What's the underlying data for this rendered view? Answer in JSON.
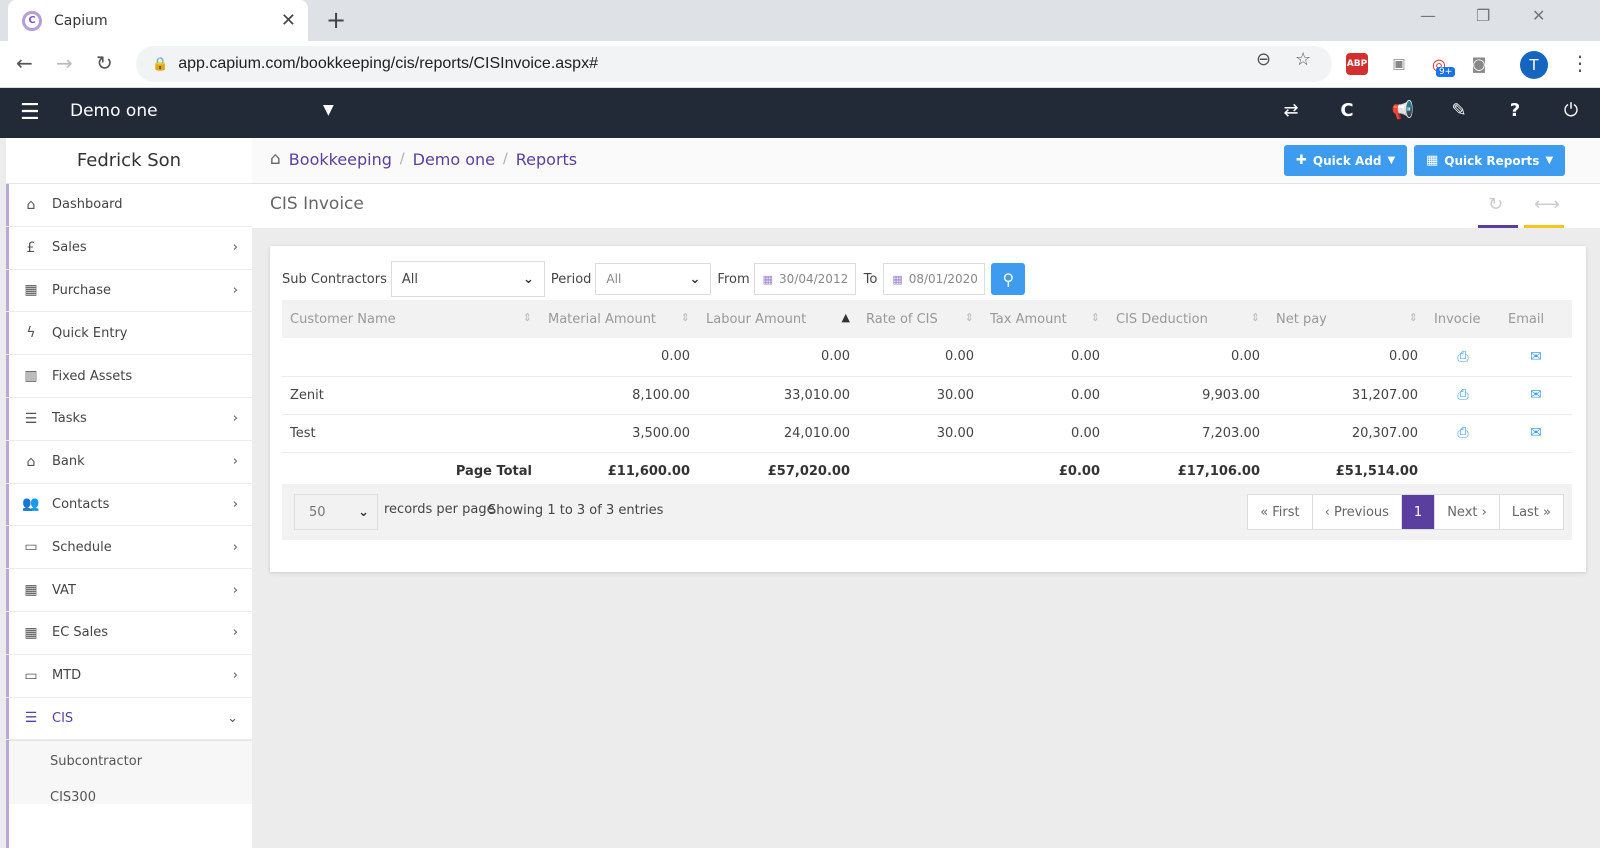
{
  "browser": {
    "tab_title": "Capium",
    "favicon": "C",
    "url": "app.capium.com/bookkeeping/cis/reports/CISInvoice.aspx#",
    "ext_abp": "ABP",
    "ext_badge": "9+",
    "avatar_initial": "T"
  },
  "appbar": {
    "company": "Demo one"
  },
  "sidebar": {
    "user": "Fedrick Son",
    "items": [
      {
        "label": "Dashboard",
        "icon": "home-icon",
        "glyph": "⌂",
        "chevron": ""
      },
      {
        "label": "Sales",
        "icon": "pound-icon",
        "glyph": "£",
        "chevron": "›"
      },
      {
        "label": "Purchase",
        "icon": "purchase-icon",
        "glyph": "▦",
        "chevron": "›"
      },
      {
        "label": "Quick Entry",
        "icon": "bolt-icon",
        "glyph": "ϟ",
        "chevron": ""
      },
      {
        "label": "Fixed Assets",
        "icon": "building-icon",
        "glyph": "▥",
        "chevron": ""
      },
      {
        "label": "Tasks",
        "icon": "tasks-icon",
        "glyph": "☰",
        "chevron": "›"
      },
      {
        "label": "Bank",
        "icon": "bank-icon",
        "glyph": "⌂",
        "chevron": "›"
      },
      {
        "label": "Contacts",
        "icon": "users-icon",
        "glyph": "👥",
        "chevron": "›"
      },
      {
        "label": "Schedule",
        "icon": "calendar-icon",
        "glyph": "▭",
        "chevron": "›"
      },
      {
        "label": "VAT",
        "icon": "calculator-icon",
        "glyph": "▦",
        "chevron": "›"
      },
      {
        "label": "EC Sales",
        "icon": "calculator-icon",
        "glyph": "▦",
        "chevron": "›"
      },
      {
        "label": "MTD",
        "icon": "calendar-icon",
        "glyph": "▭",
        "chevron": "›"
      },
      {
        "label": "CIS",
        "icon": "list-icon",
        "glyph": "☰",
        "chevron": "⌄"
      }
    ],
    "cis_sub": [
      "Subcontractor",
      "CIS300"
    ]
  },
  "breadcrumb": [
    "Bookkeeping",
    "Demo one",
    "Reports"
  ],
  "quick_add": "Quick Add",
  "quick_reports": "Quick Reports",
  "page_title": "CIS Invoice",
  "filters": {
    "subcontractors_label": "Sub Contractors",
    "subcontractors_value": "All",
    "period_label": "Period",
    "period_value": "All",
    "from_label": "From",
    "from_value": "30/04/2012",
    "to_label": "To",
    "to_value": "08/01/2020"
  },
  "table": {
    "headers": [
      "Customer Name",
      "Material Amount",
      "Labour Amount",
      "Rate of CIS",
      "Tax Amount",
      "CIS Deduction",
      "Net pay",
      "Invocie",
      "Email"
    ],
    "rows": [
      [
        "",
        "0.00",
        "0.00",
        "0.00",
        "0.00",
        "0.00",
        "0.00"
      ],
      [
        "Zenit",
        "8,100.00",
        "33,010.00",
        "30.00",
        "0.00",
        "9,903.00",
        "31,207.00"
      ],
      [
        "Test",
        "3,500.00",
        "24,010.00",
        "30.00",
        "0.00",
        "7,203.00",
        "20,307.00"
      ]
    ],
    "total": [
      "Page Total",
      "£11,600.00",
      "£57,020.00",
      "",
      "£0.00",
      "£17,106.00",
      "£51,514.00"
    ]
  },
  "footer": {
    "per_page": "50",
    "per_page_label": "records per page",
    "info": "Showing 1 to 3 of 3 entries",
    "first": "« First",
    "previous": "‹ Previous",
    "current": "1",
    "next": "Next ›",
    "last": "Last »"
  },
  "colors": {
    "appbar": "#212a36",
    "accent_purple": "#5b3fa0",
    "accent_blue": "#3d9bf0",
    "accent_yellow": "#f5c518"
  }
}
